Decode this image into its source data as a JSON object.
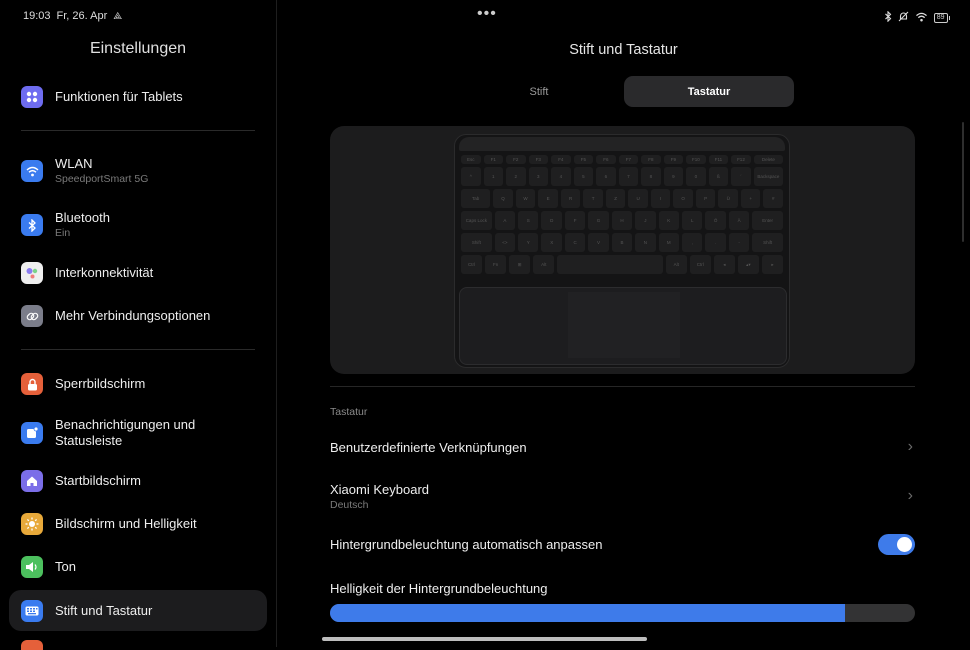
{
  "status": {
    "time": "19:03",
    "date": "Fr, 26. Apr",
    "battery": "89",
    "icons": [
      "hotspot-icon",
      "bluetooth-icon",
      "mute-icon",
      "wifi-icon",
      "battery-icon"
    ]
  },
  "sidebar": {
    "title": "Einstellungen",
    "items": [
      {
        "label": "Funktionen für Tablets",
        "icon": "tablet-features-icon",
        "color": "#6e6cf0"
      },
      {
        "label": "WLAN",
        "sub": "SpeedportSmart 5G",
        "icon": "wifi-icon",
        "color": "#3a7bef"
      },
      {
        "label": "Bluetooth",
        "sub": "Ein",
        "icon": "bluetooth-icon",
        "color": "#3a7bef"
      },
      {
        "label": "Interkonnektivität",
        "icon": "interconnectivity-icon",
        "color": "#efefef"
      },
      {
        "label": "Mehr Verbindungsoptionen",
        "icon": "link-icon",
        "color": "#7b7d8a"
      },
      {
        "label": "Sperrbildschirm",
        "icon": "lock-icon",
        "color": "#e5603a"
      },
      {
        "label": "Benachrichtigungen und Statusleiste",
        "icon": "notification-icon",
        "color": "#3a7bef"
      },
      {
        "label": "Startbildschirm",
        "icon": "home-icon",
        "color": "#7b6ee8"
      },
      {
        "label": "Bildschirm und Helligkeit",
        "icon": "brightness-icon",
        "color": "#e8a93a"
      },
      {
        "label": "Ton",
        "icon": "sound-icon",
        "color": "#4cc05e"
      },
      {
        "label": "Stift und Tastatur",
        "icon": "keyboard-icon",
        "color": "#3a7bef"
      }
    ]
  },
  "main": {
    "title": "Stift und Tastatur",
    "tabs": [
      {
        "label": "Stift"
      },
      {
        "label": "Tastatur"
      }
    ],
    "active_tab": "Tastatur",
    "section_label": "Tastatur",
    "rows": {
      "shortcuts": "Benutzerdefinierte Verknüpfungen",
      "keyboard": "Xiaomi Keyboard",
      "keyboard_sub": "Deutsch",
      "auto_backlight": "Hintergrundbeleuchtung automatisch anpassen",
      "auto_backlight_on": true,
      "brightness": "Helligkeit der Hintergrundbeleuchtung",
      "brightness_percent": 88
    },
    "keyboard_rows": [
      [
        "Esc",
        "F1",
        "F2",
        "F3",
        "F4",
        "F5",
        "F6",
        "F7",
        "F8",
        "F9",
        "F10",
        "F11",
        "F12",
        "Delete"
      ],
      [
        "^",
        "1",
        "2",
        "3",
        "4",
        "5",
        "6",
        "7",
        "8",
        "9",
        "0",
        "ß",
        "´",
        "Backspace"
      ],
      [
        "Tab",
        "Q",
        "W",
        "E",
        "R",
        "T",
        "Z",
        "U",
        "I",
        "O",
        "P",
        "Ü",
        "+",
        "#"
      ],
      [
        "Caps Lock",
        "A",
        "S",
        "D",
        "F",
        "G",
        "H",
        "J",
        "K",
        "L",
        "Ö",
        "Ä",
        "Enter"
      ],
      [
        "Shift",
        "<>",
        "Y",
        "X",
        "C",
        "V",
        "B",
        "N",
        "M",
        ",",
        ".",
        "-",
        "Shift"
      ],
      [
        "Ctrl",
        "Fn",
        "⊞",
        "Alt",
        "",
        "Alt",
        "Ctrl",
        "◂",
        "▴▾",
        "▸"
      ]
    ]
  },
  "colors": {
    "accent": "#3e7bea"
  }
}
